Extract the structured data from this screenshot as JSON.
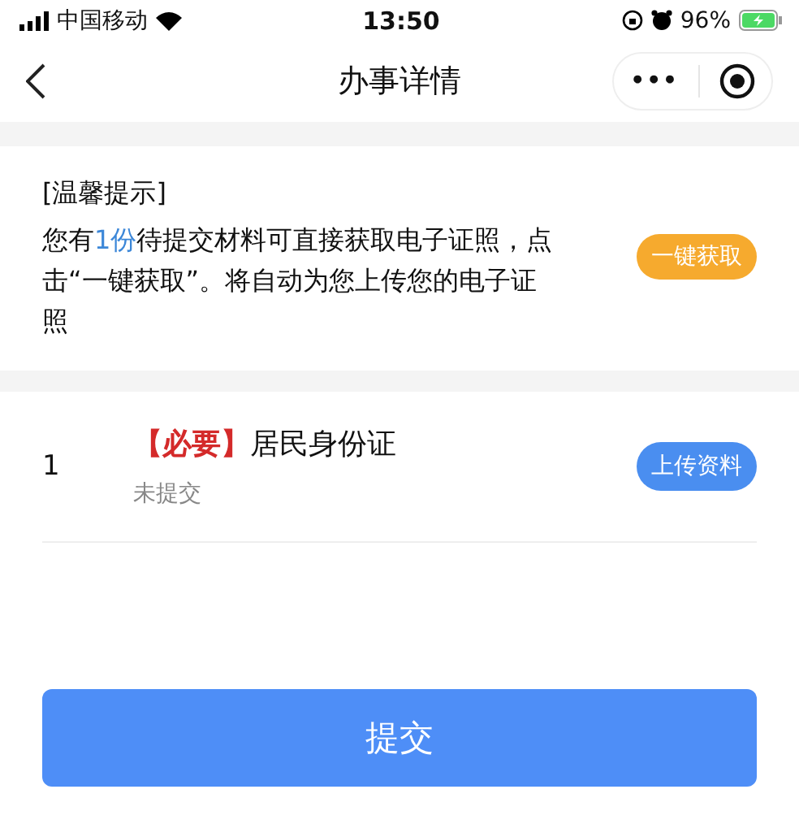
{
  "status_bar": {
    "carrier": "中国移动",
    "time": "13:50",
    "battery": "96%"
  },
  "nav": {
    "title": "办事详情",
    "more": "•••"
  },
  "notice": {
    "heading": "[温馨提示]",
    "text_before": "您有",
    "highlight": "1份",
    "text_after": "待提交材料可直接获取电子证照，点击“一键获取”。将自动为您上传您的电子证照",
    "button": "一键获取"
  },
  "materials": [
    {
      "index": "1",
      "tag": "【必要】",
      "name": "居民身份证",
      "status": "未提交",
      "button": "上传资料"
    }
  ],
  "submit": "提交"
}
